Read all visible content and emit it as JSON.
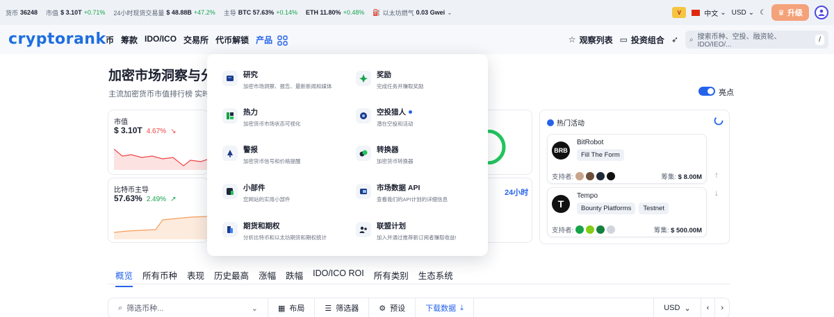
{
  "ticker": {
    "coins_label": "货币",
    "coins_value": "36248",
    "mcap_label": "市值",
    "mcap_value": "$ 3.10T",
    "mcap_change": "+0.71%",
    "vol_label": "24小时现货交易量",
    "vol_value": "$ 48.88B",
    "vol_change": "+47.2%",
    "dom_label": "主导",
    "btc_value": "BTC 57.63%",
    "btc_change": "+0.14%",
    "eth_value": "ETH 11.80%",
    "eth_change": "+0.48%",
    "gas_label": "以太坊燃气",
    "gas_value": "0.03 Gwei",
    "badge": "V",
    "language": "中文",
    "currency": "USD",
    "upgrade": "升级",
    "colors": {
      "positive": "#16a34a",
      "negative": "#ef4444",
      "accent": "#2563eb"
    }
  },
  "nav": {
    "logo": "cryptorank",
    "items": [
      "币",
      "筹款",
      "IDO/ICO",
      "交易所",
      "代币解锁",
      "产品"
    ],
    "watchlist": "观察列表",
    "portfolio": "投资组合",
    "search_placeholder": "搜索币种、空投、融资轮、IDO/IEO/...",
    "search_key": "/"
  },
  "page": {
    "title": "加密市场洞察与分",
    "subtitle": "主流加密货币市值排行榜 实时加",
    "toggle_label": "亮点"
  },
  "cards": {
    "mcap": {
      "label": "市值",
      "value": "$ 3.10T",
      "change": "4.67%"
    },
    "dominance": {
      "label": "比特币主导",
      "value": "57.63%",
      "change": "2.49%"
    },
    "right_label": "24小时"
  },
  "dropdown": {
    "items": [
      {
        "title": "研究",
        "desc": "加密市场洞察、报告、最新新闻和媒体",
        "icon": "research-icon"
      },
      {
        "title": "奖励",
        "desc": "完成任务并赚取奖励",
        "icon": "rewards-icon"
      },
      {
        "title": "热力",
        "desc": "加密货币市场状态可视化",
        "icon": "heatmap-icon"
      },
      {
        "title": "空投猎人",
        "desc": "潜在空投和活动",
        "icon": "airdrop-icon"
      },
      {
        "title": "警报",
        "desc": "加密货币信号和价格提醒",
        "icon": "alert-icon"
      },
      {
        "title": "转换器",
        "desc": "加密货币转换器",
        "icon": "converter-icon"
      },
      {
        "title": "小部件",
        "desc": "您网站的实用小部件",
        "icon": "widget-icon"
      },
      {
        "title": "市场数据 API",
        "desc": "查看我们的API计划的详细信息",
        "icon": "api-icon"
      },
      {
        "title": "期货和期权",
        "desc": "分析比特币和以太坊期货和期权统计",
        "icon": "futures-icon"
      },
      {
        "title": "联盟计划",
        "desc": "加入并通过推荐新订阅者赚取收益!",
        "icon": "affiliate-icon"
      }
    ]
  },
  "hot": {
    "title": "热门活动",
    "events": [
      {
        "logo": "BRB",
        "name": "BitRobot",
        "tags": [
          "Fill The Form"
        ],
        "support_label": "支持者:",
        "raise_label": "筹集:",
        "raise_value": "$ 8.00M"
      },
      {
        "logo": "T",
        "name": "Tempo",
        "tags": [
          "Bounty Platforms",
          "Testnet"
        ],
        "support_label": "支持者:",
        "raise_label": "筹集:",
        "raise_value": "$ 500.00M"
      }
    ]
  },
  "tabs": [
    "概览",
    "所有币种",
    "表现",
    "历史最高",
    "涨幅",
    "跌幅",
    "IDO/ICO ROI",
    "所有类别",
    "生态系统"
  ],
  "toolbar": {
    "filter_placeholder": "筛选币种...",
    "layout": "布局",
    "filter": "筛选器",
    "preset": "预设",
    "download": "下载数据",
    "currency": "USD"
  }
}
